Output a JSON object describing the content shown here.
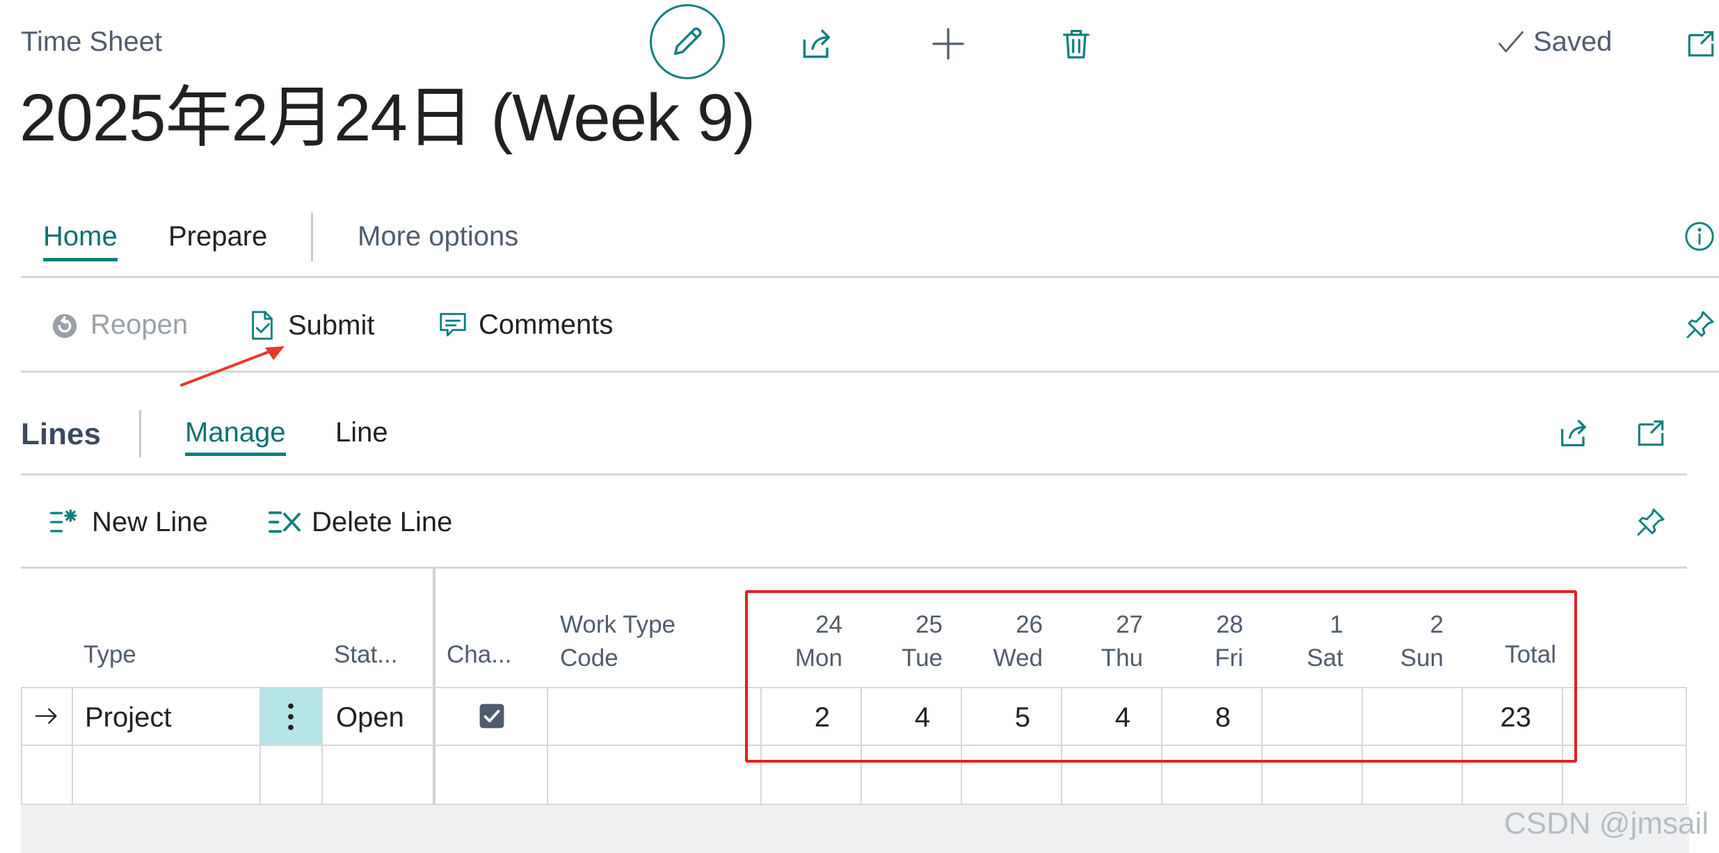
{
  "header": {
    "breadcrumb": "Time Sheet",
    "title": "2025年2月24日 (Week 9)",
    "saved_label": "Saved"
  },
  "nav_tabs": {
    "home": "Home",
    "prepare": "Prepare",
    "more": "More options"
  },
  "actions": {
    "reopen": "Reopen",
    "submit": "Submit",
    "comments": "Comments"
  },
  "lines": {
    "title": "Lines",
    "tab_manage": "Manage",
    "tab_line": "Line",
    "new_line": "New Line",
    "delete_line": "Delete Line"
  },
  "grid": {
    "headers": {
      "type": "Type",
      "status": "Stat...",
      "chargeable": "Cha...",
      "work_type_1": "Work Type",
      "work_type_2": "Code",
      "total": "Total"
    },
    "days": [
      {
        "num": "24",
        "name": "Mon"
      },
      {
        "num": "25",
        "name": "Tue"
      },
      {
        "num": "26",
        "name": "Wed"
      },
      {
        "num": "27",
        "name": "Thu"
      },
      {
        "num": "28",
        "name": "Fri"
      },
      {
        "num": "1",
        "name": "Sat"
      },
      {
        "num": "2",
        "name": "Sun"
      }
    ],
    "rows": [
      {
        "type": "Project",
        "status": "Open",
        "chargeable": true,
        "hours": [
          "2",
          "4",
          "5",
          "4",
          "8",
          "",
          ""
        ],
        "total": "23"
      }
    ]
  },
  "watermark": "CSDN @jmsail",
  "colors": {
    "accent": "#0f7f7f",
    "highlight_box": "#e02020",
    "annotation_arrow": "#e8392c",
    "selected_cell": "#b6e4e8"
  }
}
